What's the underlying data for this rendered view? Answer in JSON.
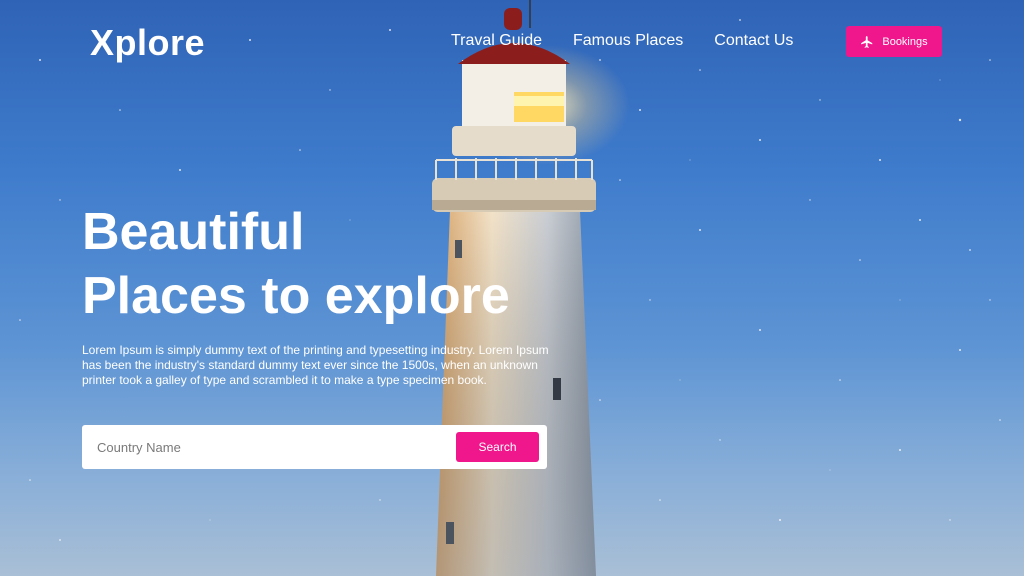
{
  "brand": {
    "logo_text": "Xplore"
  },
  "nav": {
    "links": [
      {
        "label": "Traval Guide"
      },
      {
        "label": "Famous Places"
      },
      {
        "label": "Contact Us"
      }
    ],
    "bookings_label": "Bookings",
    "bookings_icon": "airplane-icon"
  },
  "hero": {
    "headline_line1": "Beautiful",
    "headline_line2": "Places to explore",
    "description": "Lorem Ipsum is simply dummy text of the printing and typesetting industry. Lorem Ipsum has been the industry's standard dummy text ever since the 1500s, when an unknown printer took a galley of type and scrambled it to make a type specimen book."
  },
  "search": {
    "placeholder": "Country Name",
    "value": "",
    "button_label": "Search"
  },
  "colors": {
    "accent": "#f0168b",
    "sky_top": "#2f63b6",
    "sky_bottom": "#a9bfd6"
  }
}
